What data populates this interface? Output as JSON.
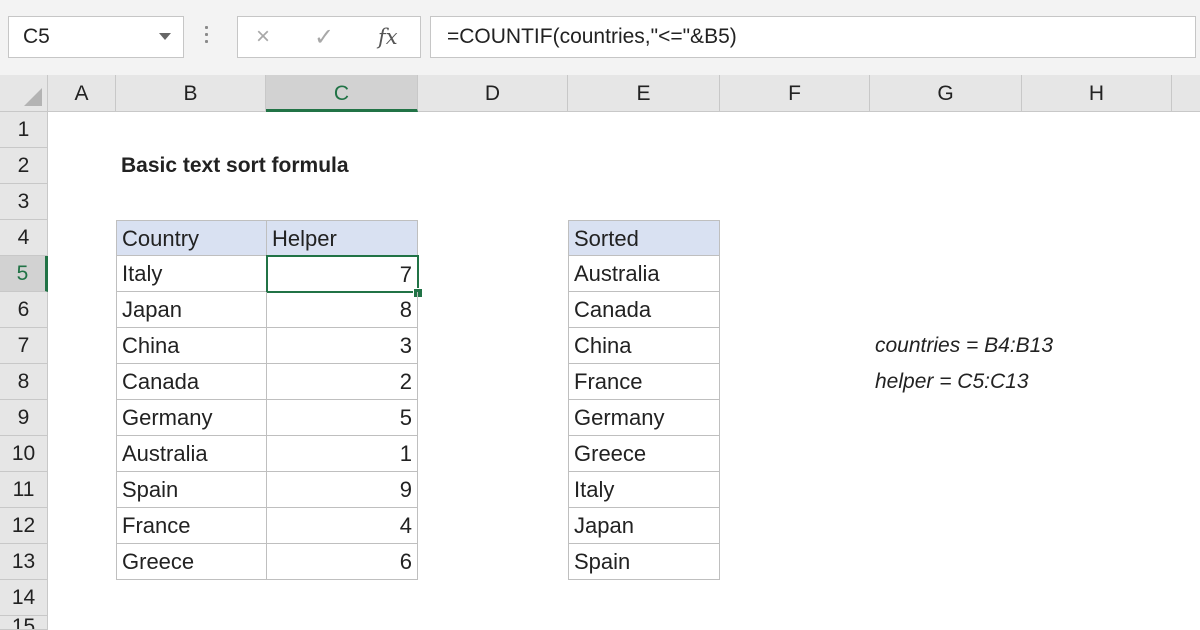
{
  "formula_bar": {
    "name_box": "C5",
    "formula": "=COUNTIF(countries,\"<=\"&B5)",
    "icons": {
      "cancel": "×",
      "enter": "✓",
      "fx": "fx"
    }
  },
  "columns": [
    "A",
    "B",
    "C",
    "D",
    "E",
    "F",
    "G",
    "H"
  ],
  "rows": [
    "1",
    "2",
    "3",
    "4",
    "5",
    "6",
    "7",
    "8",
    "9",
    "10",
    "11",
    "12",
    "13",
    "14",
    "15"
  ],
  "selected_cell": "C5",
  "sheet": {
    "title": "Basic text sort formula",
    "table1": {
      "headers": [
        "Country",
        "Helper"
      ],
      "rows": [
        {
          "country": "Italy",
          "helper": "7"
        },
        {
          "country": "Japan",
          "helper": "8"
        },
        {
          "country": "China",
          "helper": "3"
        },
        {
          "country": "Canada",
          "helper": "2"
        },
        {
          "country": "Germany",
          "helper": "5"
        },
        {
          "country": "Australia",
          "helper": "1"
        },
        {
          "country": "Spain",
          "helper": "9"
        },
        {
          "country": "France",
          "helper": "4"
        },
        {
          "country": "Greece",
          "helper": "6"
        }
      ]
    },
    "table2": {
      "header": "Sorted",
      "rows": [
        "Australia",
        "Canada",
        "China",
        "France",
        "Germany",
        "Greece",
        "Italy",
        "Japan",
        "Spain"
      ]
    },
    "notes": [
      "countries = B4:B13",
      "helper = C5:C13"
    ]
  },
  "colors": {
    "accent": "#217346",
    "header_fill": "#d9e1f2"
  }
}
